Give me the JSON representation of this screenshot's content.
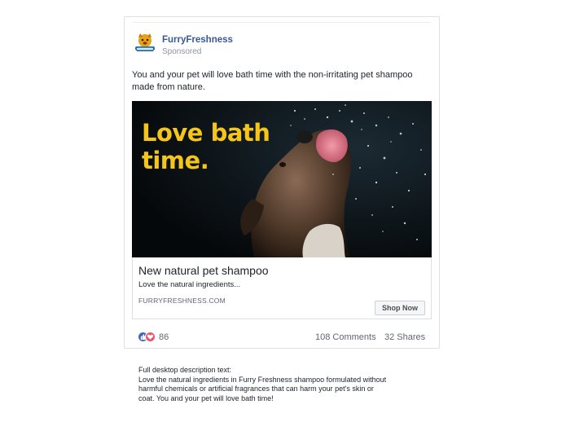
{
  "page": {
    "name": "FurryFreshness",
    "sponsored_label": "Sponsored",
    "logo_text": "Furry Freshness"
  },
  "post": {
    "primary_text": "You and your pet will love bath time with the non-irritating pet shampoo made from nature.",
    "image": {
      "headline": "Love bath\ntime.",
      "subject": "dog-shaking-water-photo"
    },
    "link": {
      "title": "New natural pet shampoo",
      "description": "Love the natural ingredients...",
      "domain": "FURRYFRESHNESS.COM",
      "cta_label": "Shop Now"
    },
    "engagement": {
      "reaction_count": "86",
      "comments": "108 Comments",
      "shares": "32 Shares"
    }
  },
  "desktop_description": {
    "label": "Full desktop description text:",
    "text": "Love the natural ingredients in Furry Freshness shampoo formulated without\nharmful chemicals or artificial fragrances that can harm your pet's skin or\ncoat. You and your pet will love bath time!"
  },
  "colors": {
    "brand_link": "#385898",
    "headline_yellow": "#f5c518",
    "like_blue": "#4267b2",
    "love_red": "#f25268"
  }
}
